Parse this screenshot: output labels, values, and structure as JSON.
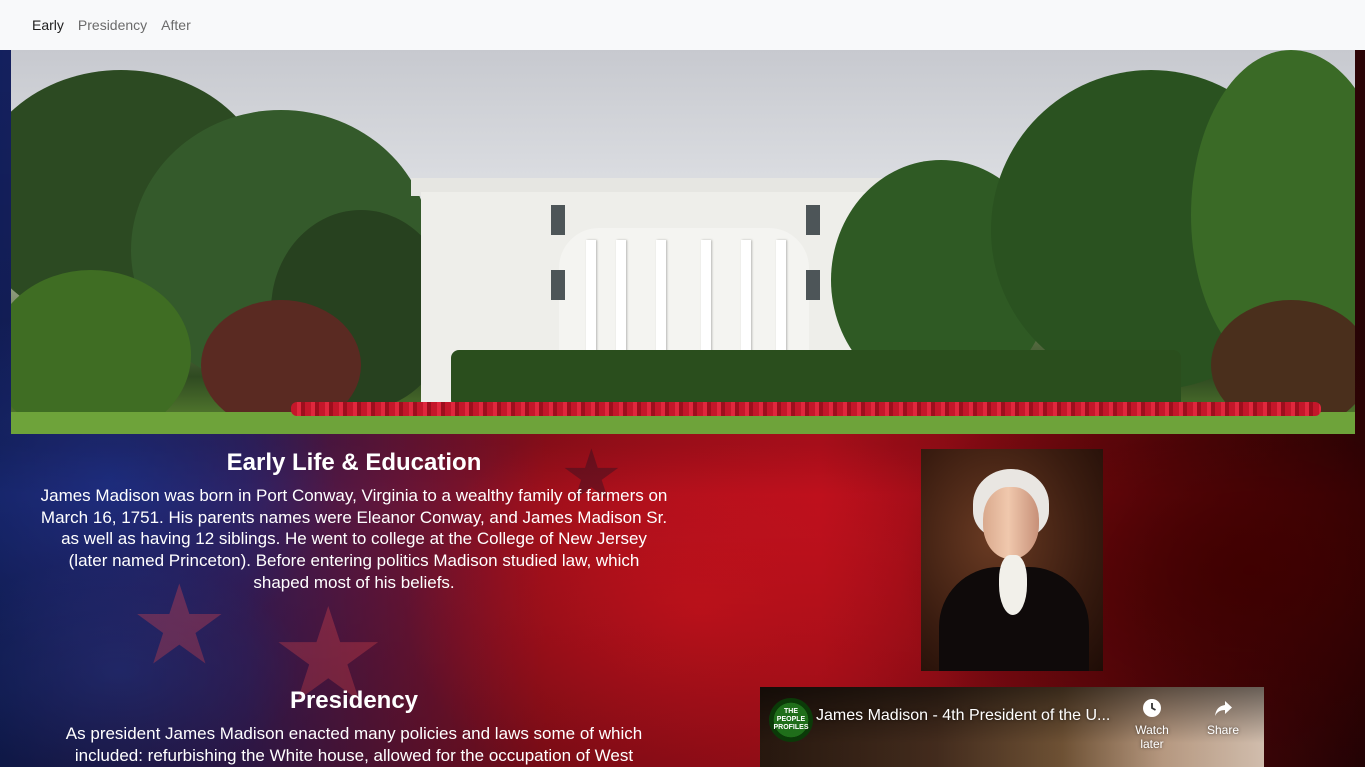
{
  "nav": {
    "items": [
      "Early",
      "Presidency",
      "After"
    ]
  },
  "sections": {
    "early": {
      "title": "Early Life & Education",
      "text": "James Madison was born in Port Conway, Virginia to a wealthy family of farmers on March 16, 1751. His parents names were Eleanor Conway, and James Madison Sr. as well as having 12 siblings. He went to college at the College of New Jersey (later named Princeton). Before entering politics Madison studied law, which shaped most of his beliefs."
    },
    "presidency": {
      "title": "Presidency",
      "text": "As president James Madison enacted many policies and laws some of which included: refurbishing the White house, allowed for the occupation of West"
    }
  },
  "video": {
    "title": "James Madison - 4th President of the U...",
    "channel_logo_text": "THE PEOPLE PROFILES",
    "watch_later": "Watch later",
    "share": "Share"
  },
  "colors": {
    "nav_bg": "#f8f9fa",
    "nav_active": "#202020",
    "nav_inactive": "#6b6b6b",
    "text": "#ffffff"
  }
}
